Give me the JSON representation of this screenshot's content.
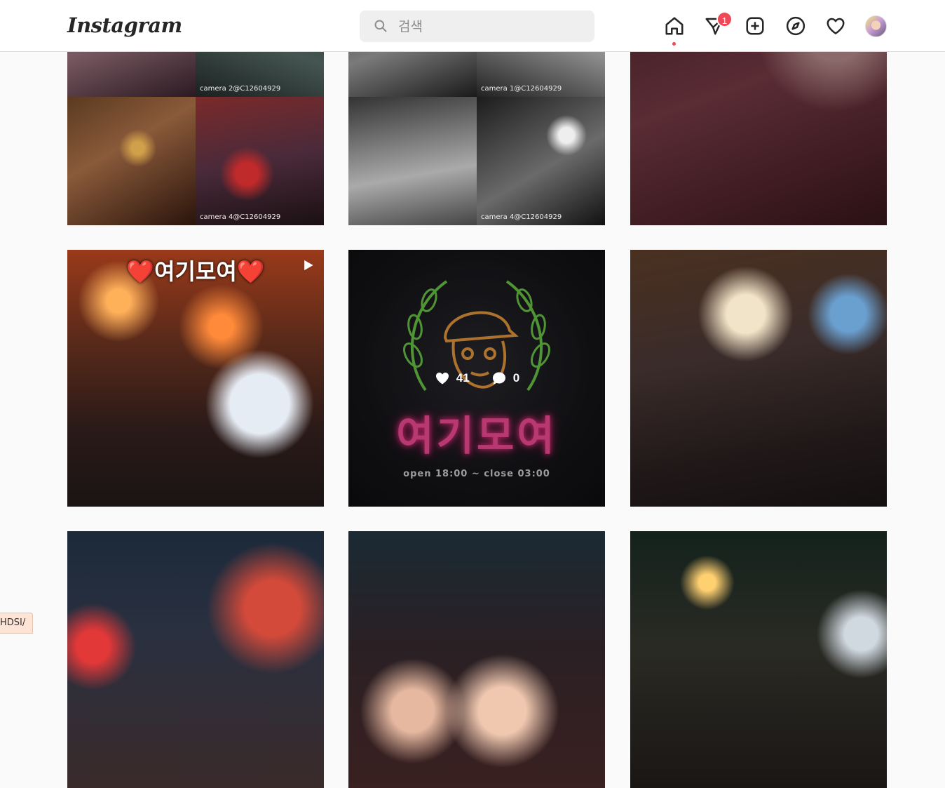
{
  "app": {
    "logo_text": "Instagram"
  },
  "search": {
    "placeholder": "검색"
  },
  "nav": {
    "icons": [
      "home-icon",
      "direct-message-icon",
      "new-post-icon",
      "explore-icon",
      "activity-heart-icon",
      "profile-avatar"
    ],
    "notification_count": "1"
  },
  "grid": {
    "rows": [
      [
        {
          "type": "cctv-collage",
          "captions": [
            "camera 2@C12604929",
            "camera 4@C12604929"
          ]
        },
        {
          "type": "cctv-collage-bw",
          "captions": [
            "camera 1@C12604929",
            "camera 4@C12604929"
          ]
        },
        {
          "type": "photo",
          "captions": []
        }
      ],
      [
        {
          "type": "video",
          "banner": "❤️여기모여❤️"
        },
        {
          "type": "neon-sign",
          "title": "여기모여",
          "hours": "open 18:00 ~ close 03:00",
          "likes": "41",
          "comments": "0"
        },
        {
          "type": "photo"
        }
      ],
      [
        {
          "type": "photo"
        },
        {
          "type": "photo"
        },
        {
          "type": "photo"
        }
      ]
    ]
  },
  "status_url": "HDSI/",
  "colors": {
    "accent": "#ed4956",
    "neon_pink": "#ff4f9e",
    "neon_green": "#6fcf4a",
    "neon_orange": "#f0a040"
  }
}
